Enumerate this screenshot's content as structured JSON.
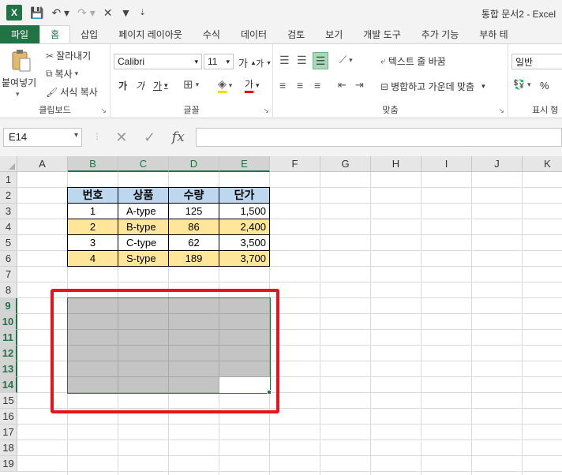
{
  "app": {
    "logo": "X",
    "title": "통합 문서2 - Excel"
  },
  "quick_access": {
    "icons": [
      "save-icon",
      "undo-icon",
      "redo-icon",
      "close-icon",
      "filter-icon",
      "customize-icon"
    ]
  },
  "tabs": [
    "파일",
    "홈",
    "삽입",
    "페이지 레이아웃",
    "수식",
    "데이터",
    "검토",
    "보기",
    "개발 도구",
    "추가 기능",
    "부하 테"
  ],
  "ribbon": {
    "clipboard": {
      "paste": "붙여넣기",
      "cut": "잘라내기",
      "copy": "복사",
      "format_painter": "서식 복사",
      "label": "클립보드"
    },
    "font": {
      "name": "Calibri",
      "size": "11",
      "grow": "가",
      "shrink": "가",
      "bold": "가",
      "italic": "가",
      "underline": "가",
      "font_color": "가",
      "label": "글꼴"
    },
    "alignment": {
      "wrap_text": "텍스트 줄 바꿈",
      "merge_center": "병합하고 가운데 맞춤",
      "label": "맞춤"
    },
    "number": {
      "format": "일반",
      "percent": "%",
      "label": "표시 형"
    }
  },
  "formula_bar": {
    "name_box": "E14",
    "fx": "fx",
    "value": ""
  },
  "columns": [
    "A",
    "B",
    "C",
    "D",
    "E",
    "F",
    "G",
    "H",
    "I",
    "J",
    "K"
  ],
  "selected_columns": [
    "B",
    "C",
    "D",
    "E"
  ],
  "rows": [
    "1",
    "2",
    "3",
    "4",
    "5",
    "6",
    "7",
    "8",
    "9",
    "10",
    "11",
    "12",
    "13",
    "14",
    "15",
    "16",
    "17",
    "18",
    "19"
  ],
  "selected_rows": [
    "9",
    "10",
    "11",
    "12",
    "13",
    "14"
  ],
  "table": {
    "headers": [
      "번호",
      "상품",
      "수량",
      "단가"
    ],
    "rows": [
      [
        "1",
        "A-type",
        "125",
        "1,500"
      ],
      [
        "2",
        "B-type",
        "86",
        "2,400"
      ],
      [
        "3",
        "C-type",
        "62",
        "3,500"
      ],
      [
        "4",
        "S-type",
        "189",
        "3,700"
      ]
    ]
  },
  "colors": {
    "excel_green": "#217346",
    "header_blue": "#bdd7ee",
    "alt_yellow": "#ffe699",
    "highlight_red": "#e8141b",
    "selection_gray": "#c4c4c4"
  }
}
